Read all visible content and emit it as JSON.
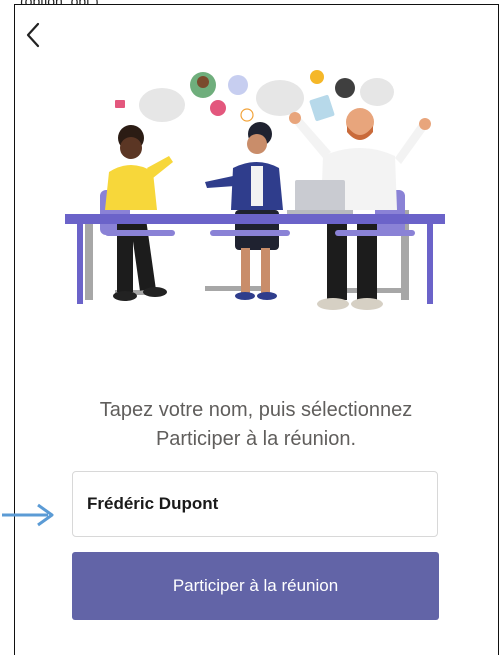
{
  "header": {
    "top_cut_text": "(option, opt.)"
  },
  "icons": {
    "back": "chevron-left-icon",
    "annotation": "arrow-right-icon"
  },
  "instruction": {
    "line1": "Tapez votre nom, puis sélectionnez",
    "line2": "Participer à la réunion."
  },
  "name_input": {
    "value": "Frédéric Dupont"
  },
  "join_button": {
    "label": "Participer à la réunion"
  },
  "colors": {
    "accent": "#6264a7",
    "table": "#6b63c9",
    "annotation_arrow": "#5b9bd5",
    "text_muted": "#605e5c"
  }
}
